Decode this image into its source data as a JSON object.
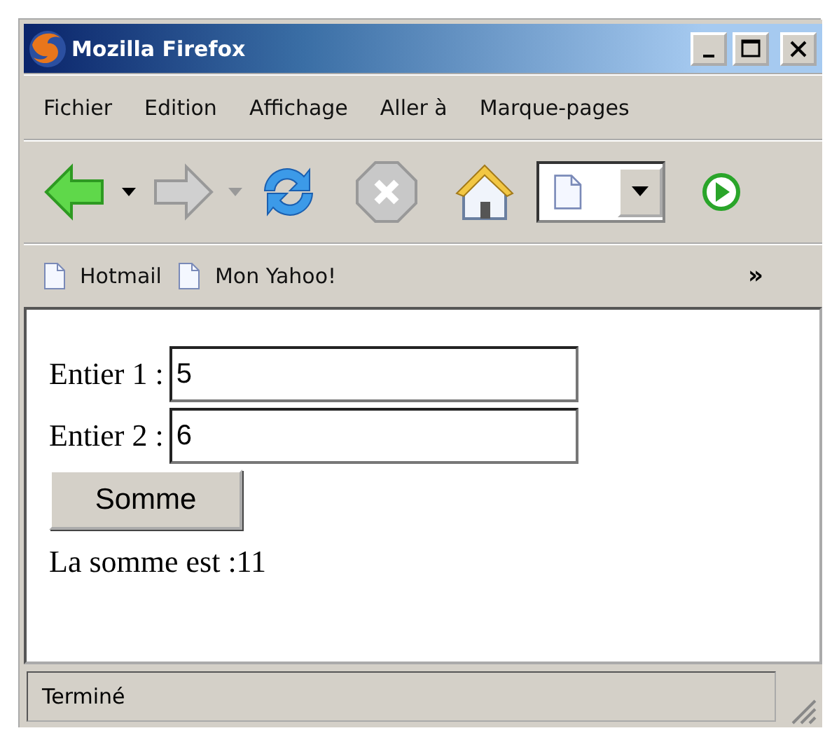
{
  "window": {
    "title": "Mozilla Firefox"
  },
  "menu": [
    "Fichier",
    "Edition",
    "Affichage",
    "Aller à",
    "Marque-pages"
  ],
  "bookmarks": [
    "Hotmail",
    "Mon Yahoo!"
  ],
  "bookmarks_overflow": "»",
  "form": {
    "fields": [
      {
        "label": "Entier 1 :",
        "value": "5"
      },
      {
        "label": "Entier 2 :",
        "value": "6"
      }
    ],
    "button": "Somme",
    "result": "La somme est :11"
  },
  "status_bar": "Terminé"
}
